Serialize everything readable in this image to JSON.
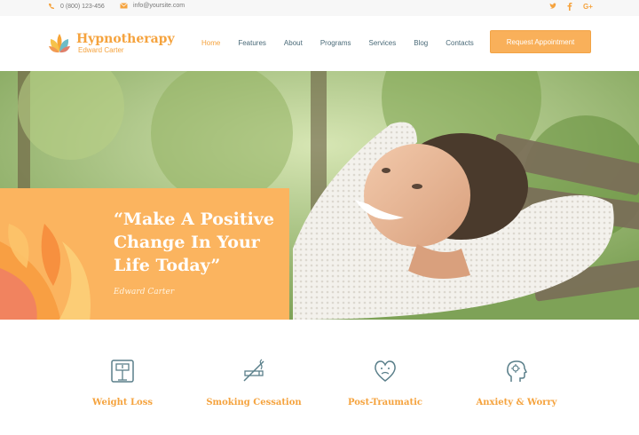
{
  "topbar": {
    "phone": "0 (800) 123-456",
    "email": "info@yoursite.com",
    "social": [
      "twitter-icon",
      "facebook-icon",
      "google-plus-icon"
    ]
  },
  "header": {
    "logo_title": "Hypnotherapy",
    "logo_subtitle": "Edward Carter",
    "nav": [
      "Home",
      "Features",
      "About",
      "Programs",
      "Services",
      "Blog",
      "Contacts"
    ],
    "nav_active": "Home",
    "cta": "Request Appointment"
  },
  "hero": {
    "quote": "“Make A Positive Change In Your Life Today”",
    "signature": "Edward Carter"
  },
  "services": [
    {
      "label": "Weight Loss",
      "icon": "scale-icon"
    },
    {
      "label": "Smoking Cessation",
      "icon": "no-smoking-icon"
    },
    {
      "label": "Post-Traumatic",
      "icon": "heart-face-icon"
    },
    {
      "label": "Anxiety & Worry",
      "icon": "head-icon"
    }
  ],
  "colors": {
    "accent": "#f5a33e",
    "cta_bg": "#f9b05a",
    "nav_text": "#4a6a78",
    "icon_stroke": "#5a7f8a"
  }
}
